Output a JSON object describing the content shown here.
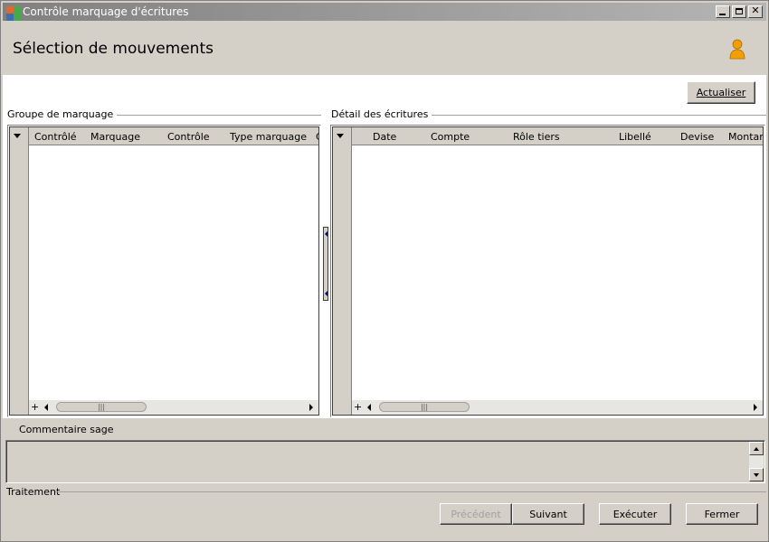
{
  "window": {
    "title": "Contrôle marquage d'écritures"
  },
  "header": {
    "page_title": "Sélection de mouvements",
    "user_icon": "user-icon"
  },
  "toolbar": {
    "refresh_label": "Actualiser"
  },
  "left_group": {
    "label": "Groupe de marquage",
    "columns": [
      "Contrôlé",
      "Marquage",
      "Contrôle",
      "Type marquage",
      "C"
    ],
    "rows": []
  },
  "right_group": {
    "label": "Détail des écritures",
    "columns": [
      "Date",
      "Compte",
      "Rôle tiers",
      "Libellé",
      "Devise",
      "Montan"
    ],
    "rows": []
  },
  "comment": {
    "label": "Commentaire sage",
    "value": ""
  },
  "footer": {
    "section_label": "Traitement",
    "prev_label": "Précédent",
    "next_label": "Suivant",
    "execute_label": "Exécuter",
    "close_label": "Fermer"
  },
  "scroll_thumb_glyph": "|||"
}
